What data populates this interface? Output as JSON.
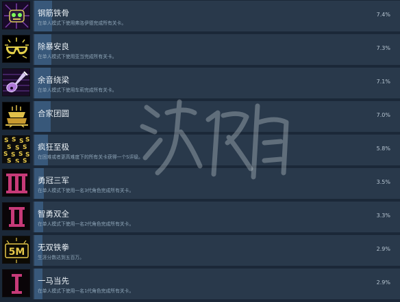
{
  "achievements": [
    {
      "title": "钢筋铁骨",
      "desc": "在单人模式下使用弗洛伊德完成所有关卡。",
      "pct": "7.4%",
      "fill": 0.074,
      "icon": "shield-face-icon"
    },
    {
      "title": "除暴安良",
      "desc": "在单人模式下使用亚当完成所有关卡。",
      "pct": "7.3%",
      "fill": 0.073,
      "icon": "sunglasses-icon"
    },
    {
      "title": "余音绕梁",
      "desc": "在单人模式下使用车莉完成所有关卡。",
      "pct": "7.1%",
      "fill": 0.071,
      "icon": "guitar-icon"
    },
    {
      "title": "合家团圆",
      "desc": "",
      "pct": "7.0%",
      "fill": 0.07,
      "icon": "cake-icon"
    },
    {
      "title": "疯狂至极",
      "desc": "在困难或者更高难度下的所有关卡获得一个S评级。",
      "pct": "5.8%",
      "fill": 0.058,
      "icon": "letter-s-pattern-icon"
    },
    {
      "title": "勇冠三军",
      "desc": "在单人模式下使用一名3代角色完成所有关卡。",
      "pct": "3.5%",
      "fill": 0.035,
      "icon": "roman-three-icon"
    },
    {
      "title": "智勇双全",
      "desc": "在单人模式下使用一名2代角色完成所有关卡。",
      "pct": "3.3%",
      "fill": 0.033,
      "icon": "roman-two-icon"
    },
    {
      "title": "无双铁拳",
      "desc": "生涯分数达到五百万。",
      "pct": "2.9%",
      "fill": 0.029,
      "icon": "five-million-icon"
    },
    {
      "title": "一马当先",
      "desc": "在单人模式下使用一名1代角色完成所有关卡。",
      "pct": "2.9%",
      "fill": 0.029,
      "icon": "roman-one-icon"
    }
  ],
  "colors": {
    "background": "#1b2838",
    "row": "#29394b",
    "bar": "#38587a",
    "icon_gold": "#d9b94a",
    "icon_pink": "#c73a78"
  }
}
